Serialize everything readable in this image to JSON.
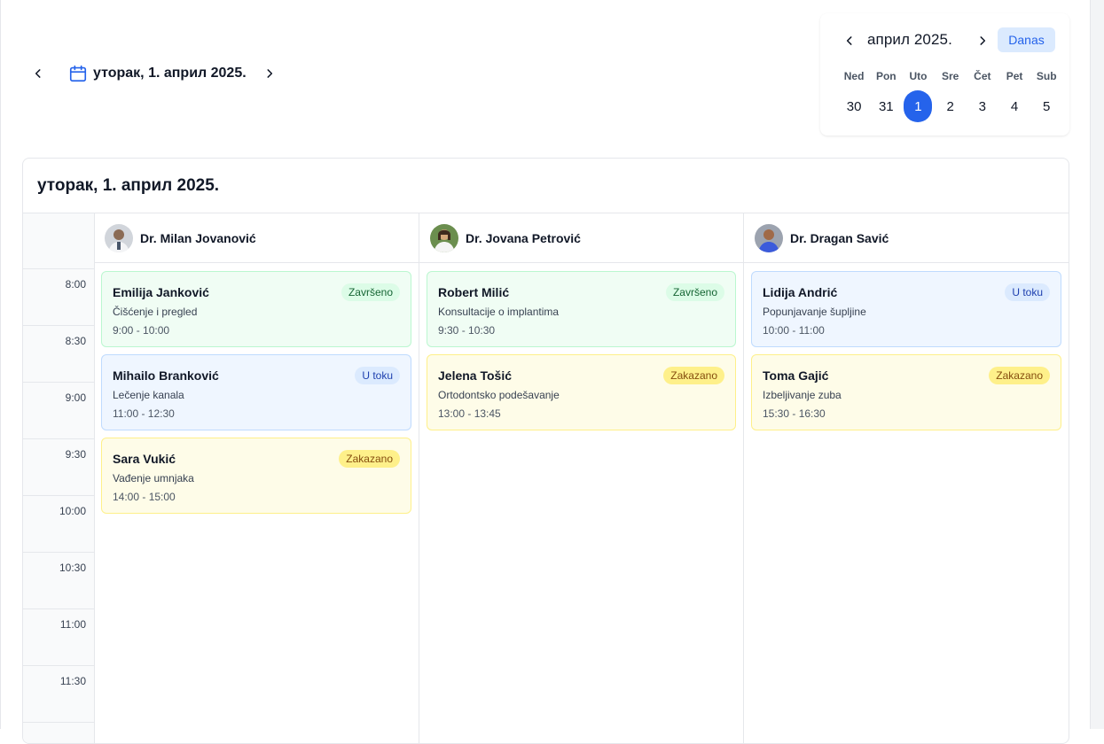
{
  "date_nav": {
    "current_date": "уторак, 1. април 2025."
  },
  "mini_calendar": {
    "month": "април 2025.",
    "today_label": "Danas",
    "weekdays": [
      "Ned",
      "Pon",
      "Uto",
      "Sre",
      "Čet",
      "Pet",
      "Sub"
    ],
    "days": [
      "30",
      "31",
      "1",
      "2",
      "3",
      "4",
      "5"
    ],
    "selected_day": "1"
  },
  "schedule": {
    "title": "уторак, 1. април 2025.",
    "time_slots": [
      "8:00",
      "8:30",
      "9:00",
      "9:30",
      "10:00",
      "10:30",
      "11:00",
      "11:30"
    ],
    "doctors": [
      {
        "name": "Dr. Milan Jovanović",
        "appointments": [
          {
            "patient": "Emilija Janković",
            "status": "Završeno",
            "status_type": "done",
            "procedure": "Čišćenje i pregled",
            "time": "9:00 - 10:00"
          },
          {
            "patient": "Mihailo Branković",
            "status": "U toku",
            "status_type": "progress",
            "procedure": "Lečenje kanala",
            "time": "11:00 - 12:30"
          },
          {
            "patient": "Sara Vukić",
            "status": "Zakazano",
            "status_type": "scheduled",
            "procedure": "Vađenje umnjaka",
            "time": "14:00 - 15:00"
          }
        ]
      },
      {
        "name": "Dr. Jovana Petrović",
        "appointments": [
          {
            "patient": "Robert Milić",
            "status": "Završeno",
            "status_type": "done",
            "procedure": "Konsultacije o implantima",
            "time": "9:30 - 10:30"
          },
          {
            "patient": "Jelena Tošić",
            "status": "Zakazano",
            "status_type": "scheduled",
            "procedure": "Ortodontsko podešavanje",
            "time": "13:00 - 13:45"
          }
        ]
      },
      {
        "name": "Dr. Dragan Savić",
        "appointments": [
          {
            "patient": "Lidija Andrić",
            "status": "U toku",
            "status_type": "progress",
            "procedure": "Popunjavanje šupljine",
            "time": "10:00 - 11:00"
          },
          {
            "patient": "Toma Gajić",
            "status": "Zakazano",
            "status_type": "scheduled",
            "procedure": "Izbeljivanje zuba",
            "time": "15:30 - 16:30"
          }
        ]
      }
    ]
  },
  "colors": {
    "accent": "#2563eb",
    "done_bg": "#f0fdf4",
    "progress_bg": "#eff6ff",
    "scheduled_bg": "#fefce8"
  }
}
